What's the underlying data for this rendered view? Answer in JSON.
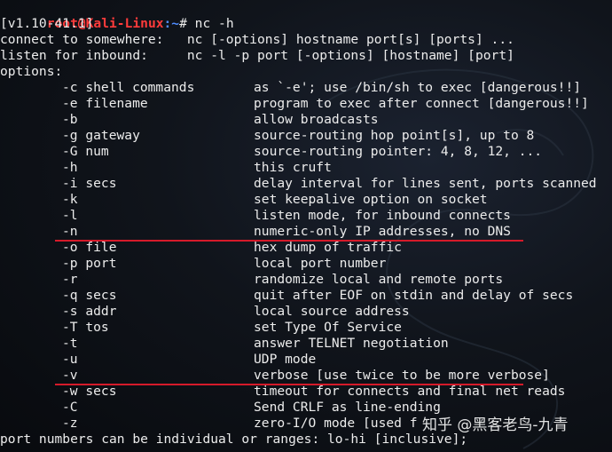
{
  "prompt": {
    "user_host": "root@Kali-Linux",
    "path": ":~",
    "sign": "# ",
    "command": "nc -h"
  },
  "header_lines": [
    "[v1.10-41.1]",
    "connect to somewhere:   nc [-options] hostname port[s] [ports] ...",
    "listen for inbound:     nc -l -p port [-options] [hostname] [port]",
    "options:"
  ],
  "options": [
    {
      "flag": "-c shell commands",
      "desc": "as `-e'; use /bin/sh to exec [dangerous!!]"
    },
    {
      "flag": "-e filename",
      "desc": "program to exec after connect [dangerous!!]"
    },
    {
      "flag": "-b",
      "desc": "allow broadcasts"
    },
    {
      "flag": "-g gateway",
      "desc": "source-routing hop point[s], up to 8"
    },
    {
      "flag": "-G num",
      "desc": "source-routing pointer: 4, 8, 12, ..."
    },
    {
      "flag": "-h",
      "desc": "this cruft"
    },
    {
      "flag": "-i secs",
      "desc": "delay interval for lines sent, ports scanned"
    },
    {
      "flag": "-k",
      "desc": "set keepalive option on socket"
    },
    {
      "flag": "-l",
      "desc": "listen mode, for inbound connects"
    },
    {
      "flag": "-n",
      "desc": "numeric-only IP addresses, no DNS"
    },
    {
      "flag": "-o file",
      "desc": "hex dump of traffic"
    },
    {
      "flag": "-p port",
      "desc": "local port number"
    },
    {
      "flag": "-r",
      "desc": "randomize local and remote ports"
    },
    {
      "flag": "-q secs",
      "desc": "quit after EOF on stdin and delay of secs"
    },
    {
      "flag": "-s addr",
      "desc": "local source address"
    },
    {
      "flag": "-T tos",
      "desc": "set Type Of Service"
    },
    {
      "flag": "-t",
      "desc": "answer TELNET negotiation"
    },
    {
      "flag": "-u",
      "desc": "UDP mode"
    },
    {
      "flag": "-v",
      "desc": "verbose [use twice to be more verbose]"
    },
    {
      "flag": "-w secs",
      "desc": "timeout for connects and final net reads"
    },
    {
      "flag": "-C",
      "desc": "Send CRLF as line-ending"
    },
    {
      "flag": "-z",
      "desc": "zero-I/O mode [used f"
    }
  ],
  "footer_lines": [
    "port numbers can be individual or ranges: lo-hi [inclusive];"
  ],
  "highlighted_flags": [
    "-n",
    "-v"
  ],
  "watermark": "知乎 @黑客老鸟-九青",
  "colors": {
    "background": "#0b0d12",
    "text": "#ececec",
    "prompt_user": "#ff3b3b",
    "prompt_path": "#4f8cff",
    "highlight_underline": "#d51a2a"
  }
}
